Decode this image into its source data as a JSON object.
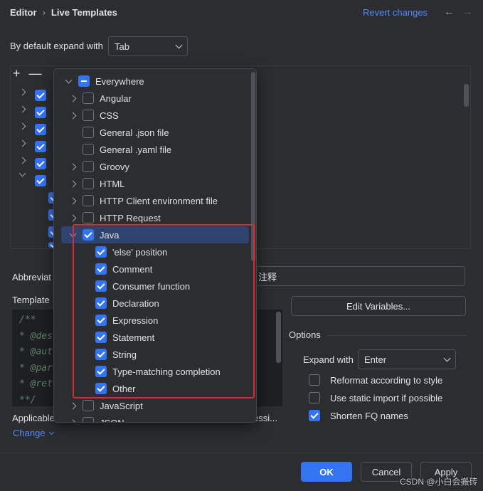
{
  "header": {
    "crumb_parent": "Editor",
    "crumb_current": "Live Templates",
    "revert": "Revert changes",
    "back_glyph": "←",
    "forward_glyph": "→"
  },
  "expand": {
    "label": "By default expand with",
    "value": "Tab"
  },
  "toolbar": {
    "add": "+",
    "remove": "—"
  },
  "partial_labels": {
    "abbreviation": "Abbreviat",
    "template_text": "Template",
    "applicable": "Applicable",
    "description_tail": "注释",
    "context_tail": "essi...",
    "change": "Change"
  },
  "code_lines": [
    "/**",
    "* @des",
    "* @aut",
    "* @par",
    "* @ret",
    "**/"
  ],
  "buttons": {
    "edit_variables": "Edit Variables...",
    "ok": "OK",
    "cancel": "Cancel",
    "apply": "Apply"
  },
  "options": {
    "title": "Options",
    "expand_with_label": "Expand with",
    "expand_with_value": "Enter",
    "reformat": "Reformat according to style",
    "static_import": "Use static import if possible",
    "shorten_fq": "Shorten FQ names",
    "reformat_checked": false,
    "static_import_checked": false,
    "shorten_fq_checked": true
  },
  "popup": {
    "root": "Everywhere",
    "items": [
      {
        "label": "Angular",
        "arrow": "right",
        "state": "off",
        "indent": 1
      },
      {
        "label": "CSS",
        "arrow": "right",
        "state": "off",
        "indent": 1
      },
      {
        "label": "General .json file",
        "arrow": "none",
        "state": "off",
        "indent": 1
      },
      {
        "label": "General .yaml file",
        "arrow": "none",
        "state": "off",
        "indent": 1
      },
      {
        "label": "Groovy",
        "arrow": "right",
        "state": "off",
        "indent": 1
      },
      {
        "label": "HTML",
        "arrow": "right",
        "state": "off",
        "indent": 1
      },
      {
        "label": "HTTP Client environment file",
        "arrow": "right",
        "state": "off",
        "indent": 1
      },
      {
        "label": "HTTP Request",
        "arrow": "right",
        "state": "off",
        "indent": 1
      },
      {
        "label": "Java",
        "arrow": "down",
        "state": "on",
        "indent": 1,
        "selected": true
      },
      {
        "label": "'else' position",
        "arrow": "none",
        "state": "on",
        "indent": 2
      },
      {
        "label": "Comment",
        "arrow": "none",
        "state": "on",
        "indent": 2
      },
      {
        "label": "Consumer function",
        "arrow": "none",
        "state": "on",
        "indent": 2
      },
      {
        "label": "Declaration",
        "arrow": "none",
        "state": "on",
        "indent": 2
      },
      {
        "label": "Expression",
        "arrow": "none",
        "state": "on",
        "indent": 2
      },
      {
        "label": "Statement",
        "arrow": "none",
        "state": "on",
        "indent": 2
      },
      {
        "label": "String",
        "arrow": "none",
        "state": "on",
        "indent": 2
      },
      {
        "label": "Type-matching completion",
        "arrow": "none",
        "state": "on",
        "indent": 2
      },
      {
        "label": "Other",
        "arrow": "none",
        "state": "on",
        "indent": 2
      },
      {
        "label": "JavaScript",
        "arrow": "right",
        "state": "off",
        "indent": 1
      },
      {
        "label": "JSON",
        "arrow": "right",
        "state": "off",
        "indent": 1
      }
    ]
  },
  "watermark": "CSDN @小白会搬砖",
  "colors": {
    "accent": "#3574f0",
    "link": "#548af7",
    "highlight_box": "#e3272e",
    "selected_row": "#2e436e"
  }
}
